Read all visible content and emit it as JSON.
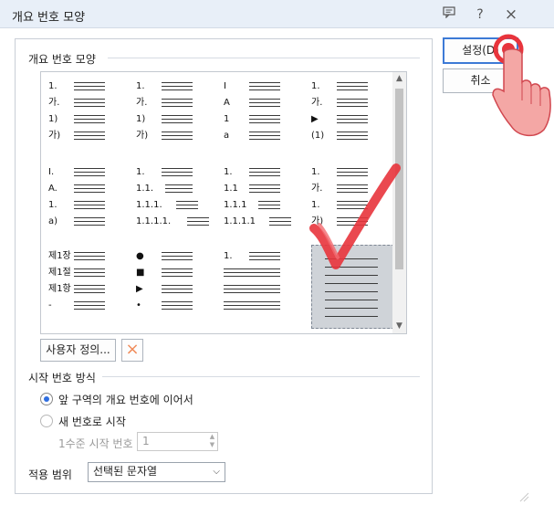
{
  "window": {
    "title": "개요 번호 모양",
    "help_icon": "?",
    "close_icon": "×"
  },
  "group_label": "개요 번호 모양",
  "numbering_presets": [
    {
      "rows": [
        "1.",
        "가.",
        "1)",
        "가)"
      ]
    },
    {
      "rows": [
        "1.",
        "가.",
        "1)",
        "가)"
      ]
    },
    {
      "rows": [
        "I",
        "A",
        "1",
        "a"
      ]
    },
    {
      "rows": [
        "1.",
        "가.",
        "▶",
        "(1)"
      ]
    },
    {
      "rows": [
        "I.",
        "A.",
        "1.",
        "a)"
      ]
    },
    {
      "rows": [
        "1.",
        "1.1.",
        "1.1.1.",
        "1.1.1.1."
      ]
    },
    {
      "rows": [
        "1.",
        "1.1",
        "1.1.1",
        "1.1.1.1"
      ]
    },
    {
      "rows": [
        "1.",
        "가.",
        "1.",
        "가)"
      ]
    },
    {
      "rows": [
        "제1장",
        "제1절",
        "제1항",
        "-"
      ]
    },
    {
      "rows": [
        "●",
        "■",
        "▶",
        "•"
      ]
    },
    {
      "rows": [
        "1.",
        "",
        "",
        ""
      ]
    },
    {
      "rows": [
        "",
        "",
        "",
        ""
      ]
    }
  ],
  "selected_preset_index": 11,
  "buttons": {
    "ok": "설정(D)",
    "cancel": "취소",
    "custom": "사용자 정의...",
    "delete_icon": "×"
  },
  "start_number": {
    "label": "시작 번호 방식",
    "option_continue": "앞 구역의 개요 번호에 이어서",
    "option_new": "새 번호로 시작",
    "level1_label": "1수준 시작 번호",
    "level1_value": "1"
  },
  "apply_scope": {
    "label": "적용 범위",
    "value": "선택된 문자열"
  },
  "colors": {
    "accent": "#3d7ad6",
    "annotation_red": "#e8343c"
  }
}
